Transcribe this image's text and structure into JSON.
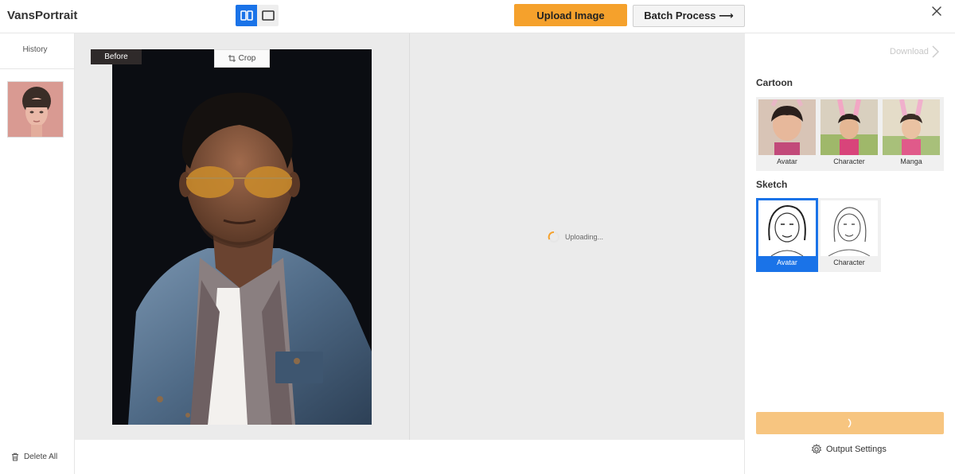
{
  "header": {
    "logo": "VansPortrait",
    "upload_label": "Upload Image",
    "batch_label": "Batch Process ⟶",
    "colors": {
      "accent": "#f5a12c",
      "toggle_active": "#1a73e8"
    }
  },
  "sidebar": {
    "history_label": "History",
    "delete_all_label": "Delete All",
    "history_items": [
      {
        "icon": "portrait-thumbnail"
      }
    ]
  },
  "workspace": {
    "before_label": "Before",
    "crop_label": "Crop",
    "status_text": "Uploading..."
  },
  "right_panel": {
    "download_label": "Download",
    "sections": [
      {
        "title": "Cartoon",
        "styles": [
          {
            "label": "Avatar",
            "selected": false
          },
          {
            "label": "Character",
            "selected": false
          },
          {
            "label": "Manga",
            "selected": false
          }
        ]
      },
      {
        "title": "Sketch",
        "styles": [
          {
            "label": "Avatar",
            "selected": true
          },
          {
            "label": "Character",
            "selected": false
          }
        ]
      }
    ],
    "output_settings_label": "Output Settings"
  }
}
